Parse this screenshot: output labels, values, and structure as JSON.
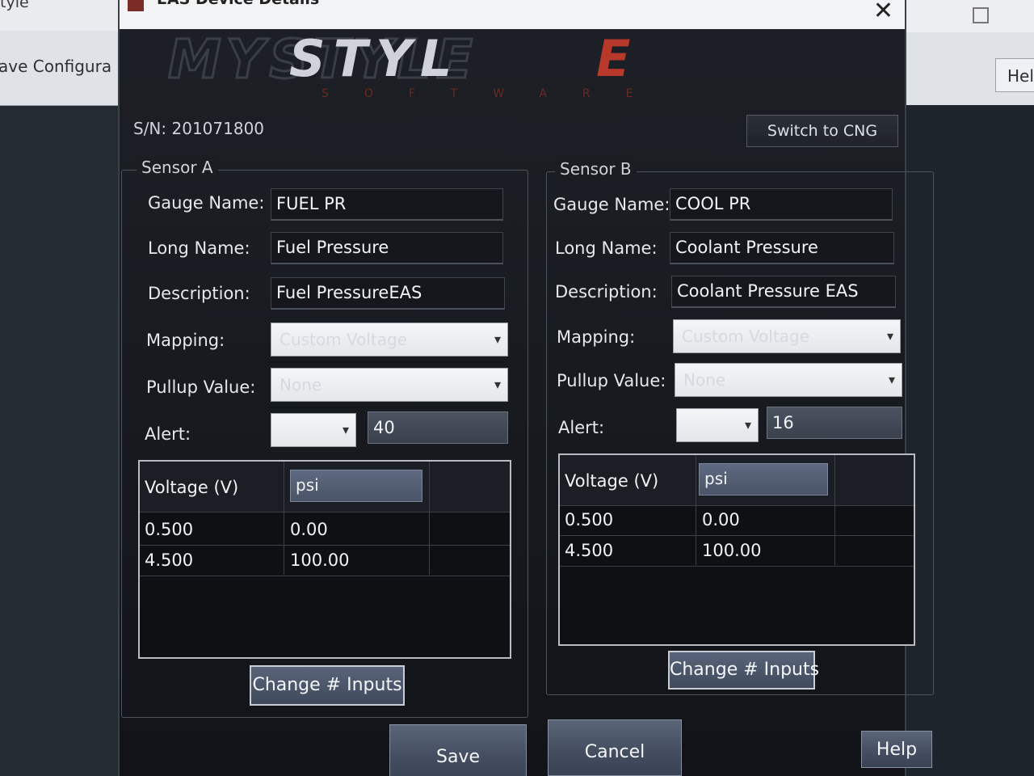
{
  "background_left": {
    "app_title": "tyle",
    "menu_label": "ave Configura"
  },
  "background_right": {
    "help_label": "Hel"
  },
  "dialog": {
    "title": "EAS Device Details",
    "logo_text": "MYSTYLE",
    "logo_sub": "SOFTWARE",
    "serial": "S/N: 201071800",
    "switch_label": "Switch to CNG",
    "save_label": "Save",
    "cancel_label": "Cancel",
    "help_label": "Help"
  },
  "labels": {
    "gauge_name": "Gauge Name:",
    "long_name": "Long Name:",
    "description": "Description:",
    "mapping": "Mapping:",
    "pullup": "Pullup Value:",
    "alert": "Alert:",
    "voltage_header": "Voltage (V)",
    "change_inputs": "Change # Inputs"
  },
  "sensor_a": {
    "legend": "Sensor A",
    "gauge_name": "FUEL PR",
    "long_name": "Fuel Pressure",
    "description": "Fuel PressureEAS",
    "mapping": "Custom Voltage",
    "pullup": "None",
    "alert_value": "40",
    "unit": "psi",
    "rows": [
      {
        "voltage": "0.500",
        "value": "0.00"
      },
      {
        "voltage": "4.500",
        "value": "100.00"
      }
    ]
  },
  "sensor_b": {
    "legend": "Sensor B",
    "gauge_name": "COOL PR",
    "long_name": "Coolant Pressure",
    "description": "Coolant Pressure EAS",
    "mapping": "Custom Voltage",
    "pullup": "None",
    "alert_value": "16",
    "unit": "psi",
    "rows": [
      {
        "voltage": "0.500",
        "value": "0.00"
      },
      {
        "voltage": "4.500",
        "value": "100.00"
      }
    ]
  },
  "colors": {
    "logo_gray": "#cfd3d9",
    "logo_red": "#b8382c",
    "dialog_bg": "#1a1d22"
  }
}
